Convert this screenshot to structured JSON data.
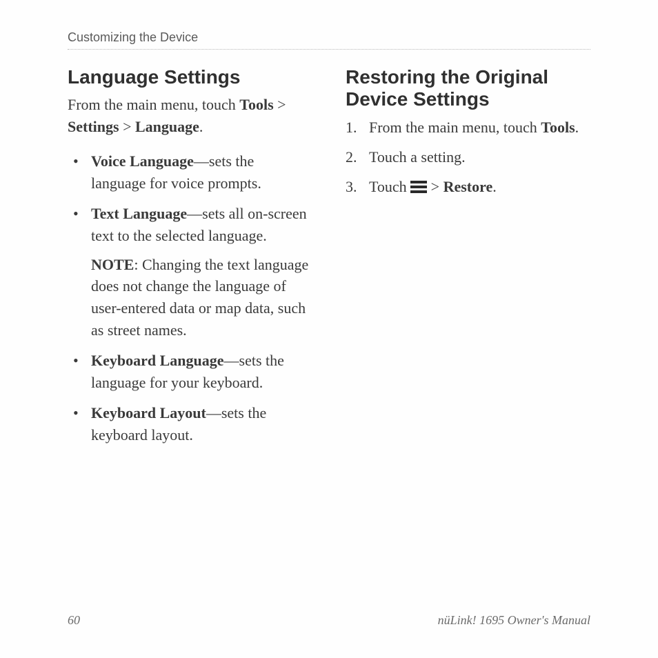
{
  "header": {
    "section": "Customizing the Device"
  },
  "left": {
    "title": "Language Settings",
    "intro_parts": {
      "p1": "From the main menu, touch ",
      "b1": "Tools",
      "p2": " > ",
      "b2": "Settings",
      "p3": " > ",
      "b3": "Language",
      "p4": "."
    },
    "bullets": {
      "voice": {
        "label": "Voice Language",
        "desc": "sets the language for voice prompts."
      },
      "text": {
        "label": "Text Language",
        "desc": "sets all on-screen text to the selected language."
      },
      "text_note": {
        "label": "NOTE",
        "body": ": Changing the text language does not change the language of user-entered data or map data, such as street names."
      },
      "keyboard_lang": {
        "label": "Keyboard Language",
        "desc": "sets the language for your keyboard."
      },
      "keyboard_layout": {
        "label": "Keyboard Layout",
        "desc": "sets the keyboard layout."
      }
    }
  },
  "right": {
    "title": "Restoring the Original Device Settings",
    "steps": {
      "s1": {
        "p1": "From the main menu, touch ",
        "b1": "Tools",
        "p2": "."
      },
      "s2": {
        "text": "Touch a setting."
      },
      "s3": {
        "p1": "Touch ",
        "p2": " > ",
        "b1": "Restore",
        "p3": "."
      }
    },
    "icons": {
      "menu": "menu-icon"
    }
  },
  "footer": {
    "page": "60",
    "manual": "nüLink! 1695 Owner's Manual"
  }
}
